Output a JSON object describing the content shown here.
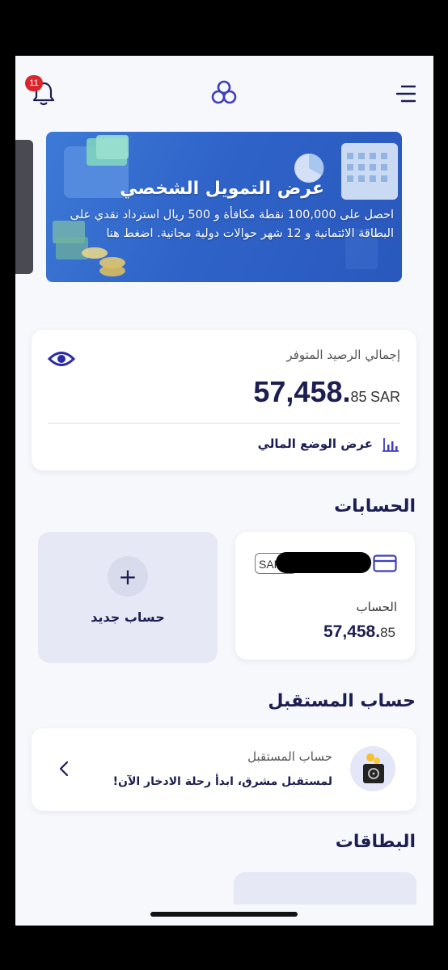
{
  "header": {
    "notification_count": "11",
    "icons": [
      "bell-icon",
      "bank-logo-icon",
      "menu-icon"
    ]
  },
  "banner": {
    "title": "عرض التمويل الشخصي",
    "text": "احصل على 100,000 نقطة مكافأة و 500 ريال استرداد نقدي على البطاقة الائتمانية و 12 شهر حوالات دولية مجانية. اضغط هنا"
  },
  "balance": {
    "label": "إجمالي الرصيد المتوفر",
    "amount_main": "57,458.",
    "amount_decimals": "85",
    "currency": "SAR",
    "link_label": "عرض الوضع المالي"
  },
  "accounts": {
    "section_title": "الحسابات",
    "account": {
      "currency_badge": "SAR",
      "label": "الحساب",
      "amount_main": "57,458.",
      "amount_decimals": "85"
    },
    "new_account": {
      "plus": "+",
      "label": "حساب جديد"
    }
  },
  "future": {
    "section_title": "حساب المستقبل",
    "title": "حساب المستقبل",
    "subtitle": "لمستقبل مشرق، ابدأ رحلة الادخار الآن!"
  },
  "cards": {
    "section_title": "البطاقات"
  },
  "colors": {
    "navy": "#1c1e52",
    "accent": "#3f3fb8",
    "badge": "#d9262c",
    "background": "#f7f8fc"
  }
}
